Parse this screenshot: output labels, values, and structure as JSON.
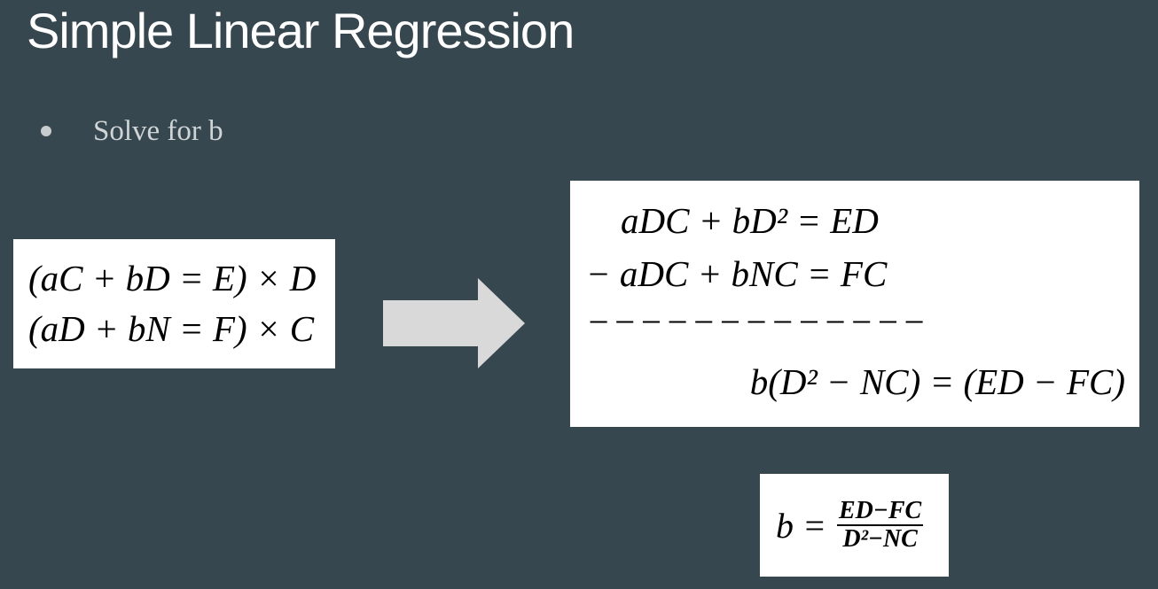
{
  "slide": {
    "title": "Simple Linear Regression",
    "bullet": "Solve for b"
  },
  "left_box": {
    "line1": "(aC + bD = E) × D",
    "line2": "(aD + bN = F) × C"
  },
  "arrow": {
    "icon": "right-arrow-icon",
    "color": "#d9d9d9"
  },
  "right_box": {
    "line1": "aDC + bD² = ED",
    "line2": "− aDC + bNC = FC",
    "line3": "−−−−−−−−−−−−−",
    "line4": "b(D² − NC) = (ED − FC)"
  },
  "result_box": {
    "lhs": "b =",
    "numerator": "ED−FC",
    "denominator": "D²−NC"
  },
  "colors": {
    "background": "#37474f",
    "title": "#ffffff",
    "bullet_text": "#cfd4d6",
    "box": "#ffffff"
  }
}
